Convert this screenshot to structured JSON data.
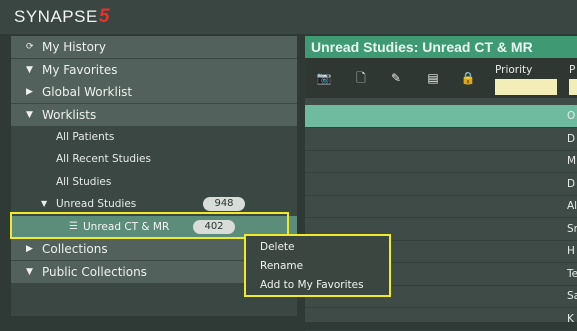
{
  "app": {
    "brand": "SYNAPSE",
    "brand_version": "5"
  },
  "nav": {
    "my_history": "My History",
    "my_favorites": "My Favorites",
    "global_worklist": "Global Worklist",
    "worklists": "Worklists",
    "all_patients": "All Patients",
    "all_recent_studies": "All Recent Studies",
    "all_studies": "All Studies",
    "unread_studies": "Unread Studies",
    "unread_studies_count": "948",
    "unread_ct_mr": "Unread CT & MR",
    "unread_ct_mr_count": "402",
    "collections": "Collections",
    "public_collections": "Public Collections"
  },
  "panel": {
    "title": "Unread Studies: Unread CT & MR",
    "priority_label": "Priority",
    "next_col_label": "P",
    "rows": [
      "O",
      "D",
      "M",
      "D",
      "Al",
      "Sr",
      "H",
      "Te",
      "Sa",
      "K"
    ]
  },
  "context_menu": {
    "items": [
      "Delete",
      "Rename",
      "Add to My Favorites"
    ]
  },
  "colors": {
    "accent": "#3f9a74",
    "highlight": "#f0ea2c",
    "selected_row": "#6fbba0",
    "brand_red": "#e2342b"
  }
}
